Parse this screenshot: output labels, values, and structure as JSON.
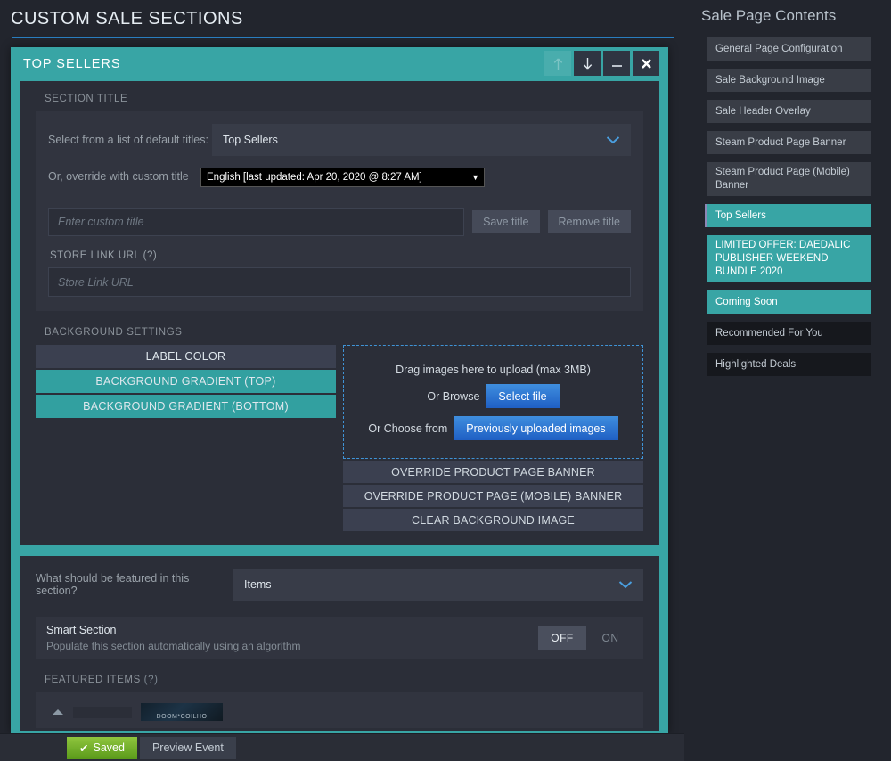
{
  "header": {
    "page_title": "CUSTOM SALE SECTIONS",
    "rule_color": "#2a7ec0"
  },
  "panel": {
    "title": "TOP SELLERS",
    "accent_color": "#38a5a5",
    "buttons": [
      {
        "name": "move-up",
        "glyph": "arrow-up",
        "disabled": true
      },
      {
        "name": "move-down",
        "glyph": "arrow-down",
        "disabled": false
      },
      {
        "name": "minimize",
        "glyph": "minimize",
        "disabled": false
      },
      {
        "name": "close",
        "glyph": "close",
        "disabled": false
      }
    ]
  },
  "section_title": {
    "label": "SECTION TITLE",
    "default_titles_label": "Select from a list of default titles:",
    "default_titles_value": "Top Sellers",
    "override_label": "Or, override with custom title",
    "language_value": "English [last updated: Apr 20, 2020 @ 8:27 AM]",
    "custom_title_value": "",
    "custom_title_placeholder": "Enter custom title",
    "save_title_label": "Save title",
    "remove_title_label": "Remove title",
    "store_link_label": "STORE LINK URL",
    "store_link_hint": "(?)",
    "store_link_value": "",
    "store_link_placeholder": "Store Link URL"
  },
  "background_settings": {
    "label": "BACKGROUND SETTINGS",
    "buttons": [
      {
        "label": "LABEL COLOR",
        "style": "dark"
      },
      {
        "label": "BACKGROUND GRADIENT (TOP)",
        "style": "teal"
      },
      {
        "label": "BACKGROUND GRADIENT (BOTTOM)",
        "style": "teal"
      }
    ],
    "dropzone": {
      "drag_text": "Drag images here to upload (max 3MB)",
      "browse_label": "Or Browse",
      "select_file_label": "Select file",
      "choose_label": "Or Choose from",
      "previous_label": "Previously uploaded images",
      "border_color": "#3f93d6"
    },
    "override_buttons": [
      "OVERRIDE PRODUCT PAGE BANNER",
      "OVERRIDE PRODUCT PAGE (MOBILE) BANNER",
      "CLEAR BACKGROUND IMAGE"
    ]
  },
  "featured": {
    "question_label": "What should be featured in this section?",
    "question_value": "Items",
    "smart_section_title": "Smart Section",
    "smart_section_sub": "Populate this section automatically using an algorithm",
    "toggle_off_label": "OFF",
    "toggle_on_label": "ON",
    "toggle_state": "OFF",
    "featured_items_label": "FEATURED ITEMS",
    "featured_items_hint": "(?)",
    "first_item_thumb_text": "DOOM*COILHO"
  },
  "sidebar": {
    "title": "Sale Page Contents",
    "items": [
      {
        "label": "General Page Configuration",
        "style": "grey",
        "active": false
      },
      {
        "label": "Sale Background Image",
        "style": "grey",
        "active": false
      },
      {
        "label": "Sale Header Overlay",
        "style": "grey",
        "active": false
      },
      {
        "label": "Steam Product Page Banner",
        "style": "grey",
        "active": false
      },
      {
        "label": "Steam Product Page (Mobile) Banner",
        "style": "grey",
        "active": false
      },
      {
        "label": "Top Sellers",
        "style": "teal",
        "active": true
      },
      {
        "label": "LIMITED OFFER: DAEDALIC PUBLISHER WEEKEND BUNDLE 2020",
        "style": "teal",
        "active": false
      },
      {
        "label": "Coming Soon",
        "style": "teal",
        "active": false
      },
      {
        "label": "Recommended For You",
        "style": "dark",
        "active": false
      },
      {
        "label": "Highlighted Deals",
        "style": "dark",
        "active": false
      }
    ]
  },
  "bottom_bar": {
    "saved_label": "Saved",
    "saved_check": "✔",
    "preview_label": "Preview Event"
  }
}
